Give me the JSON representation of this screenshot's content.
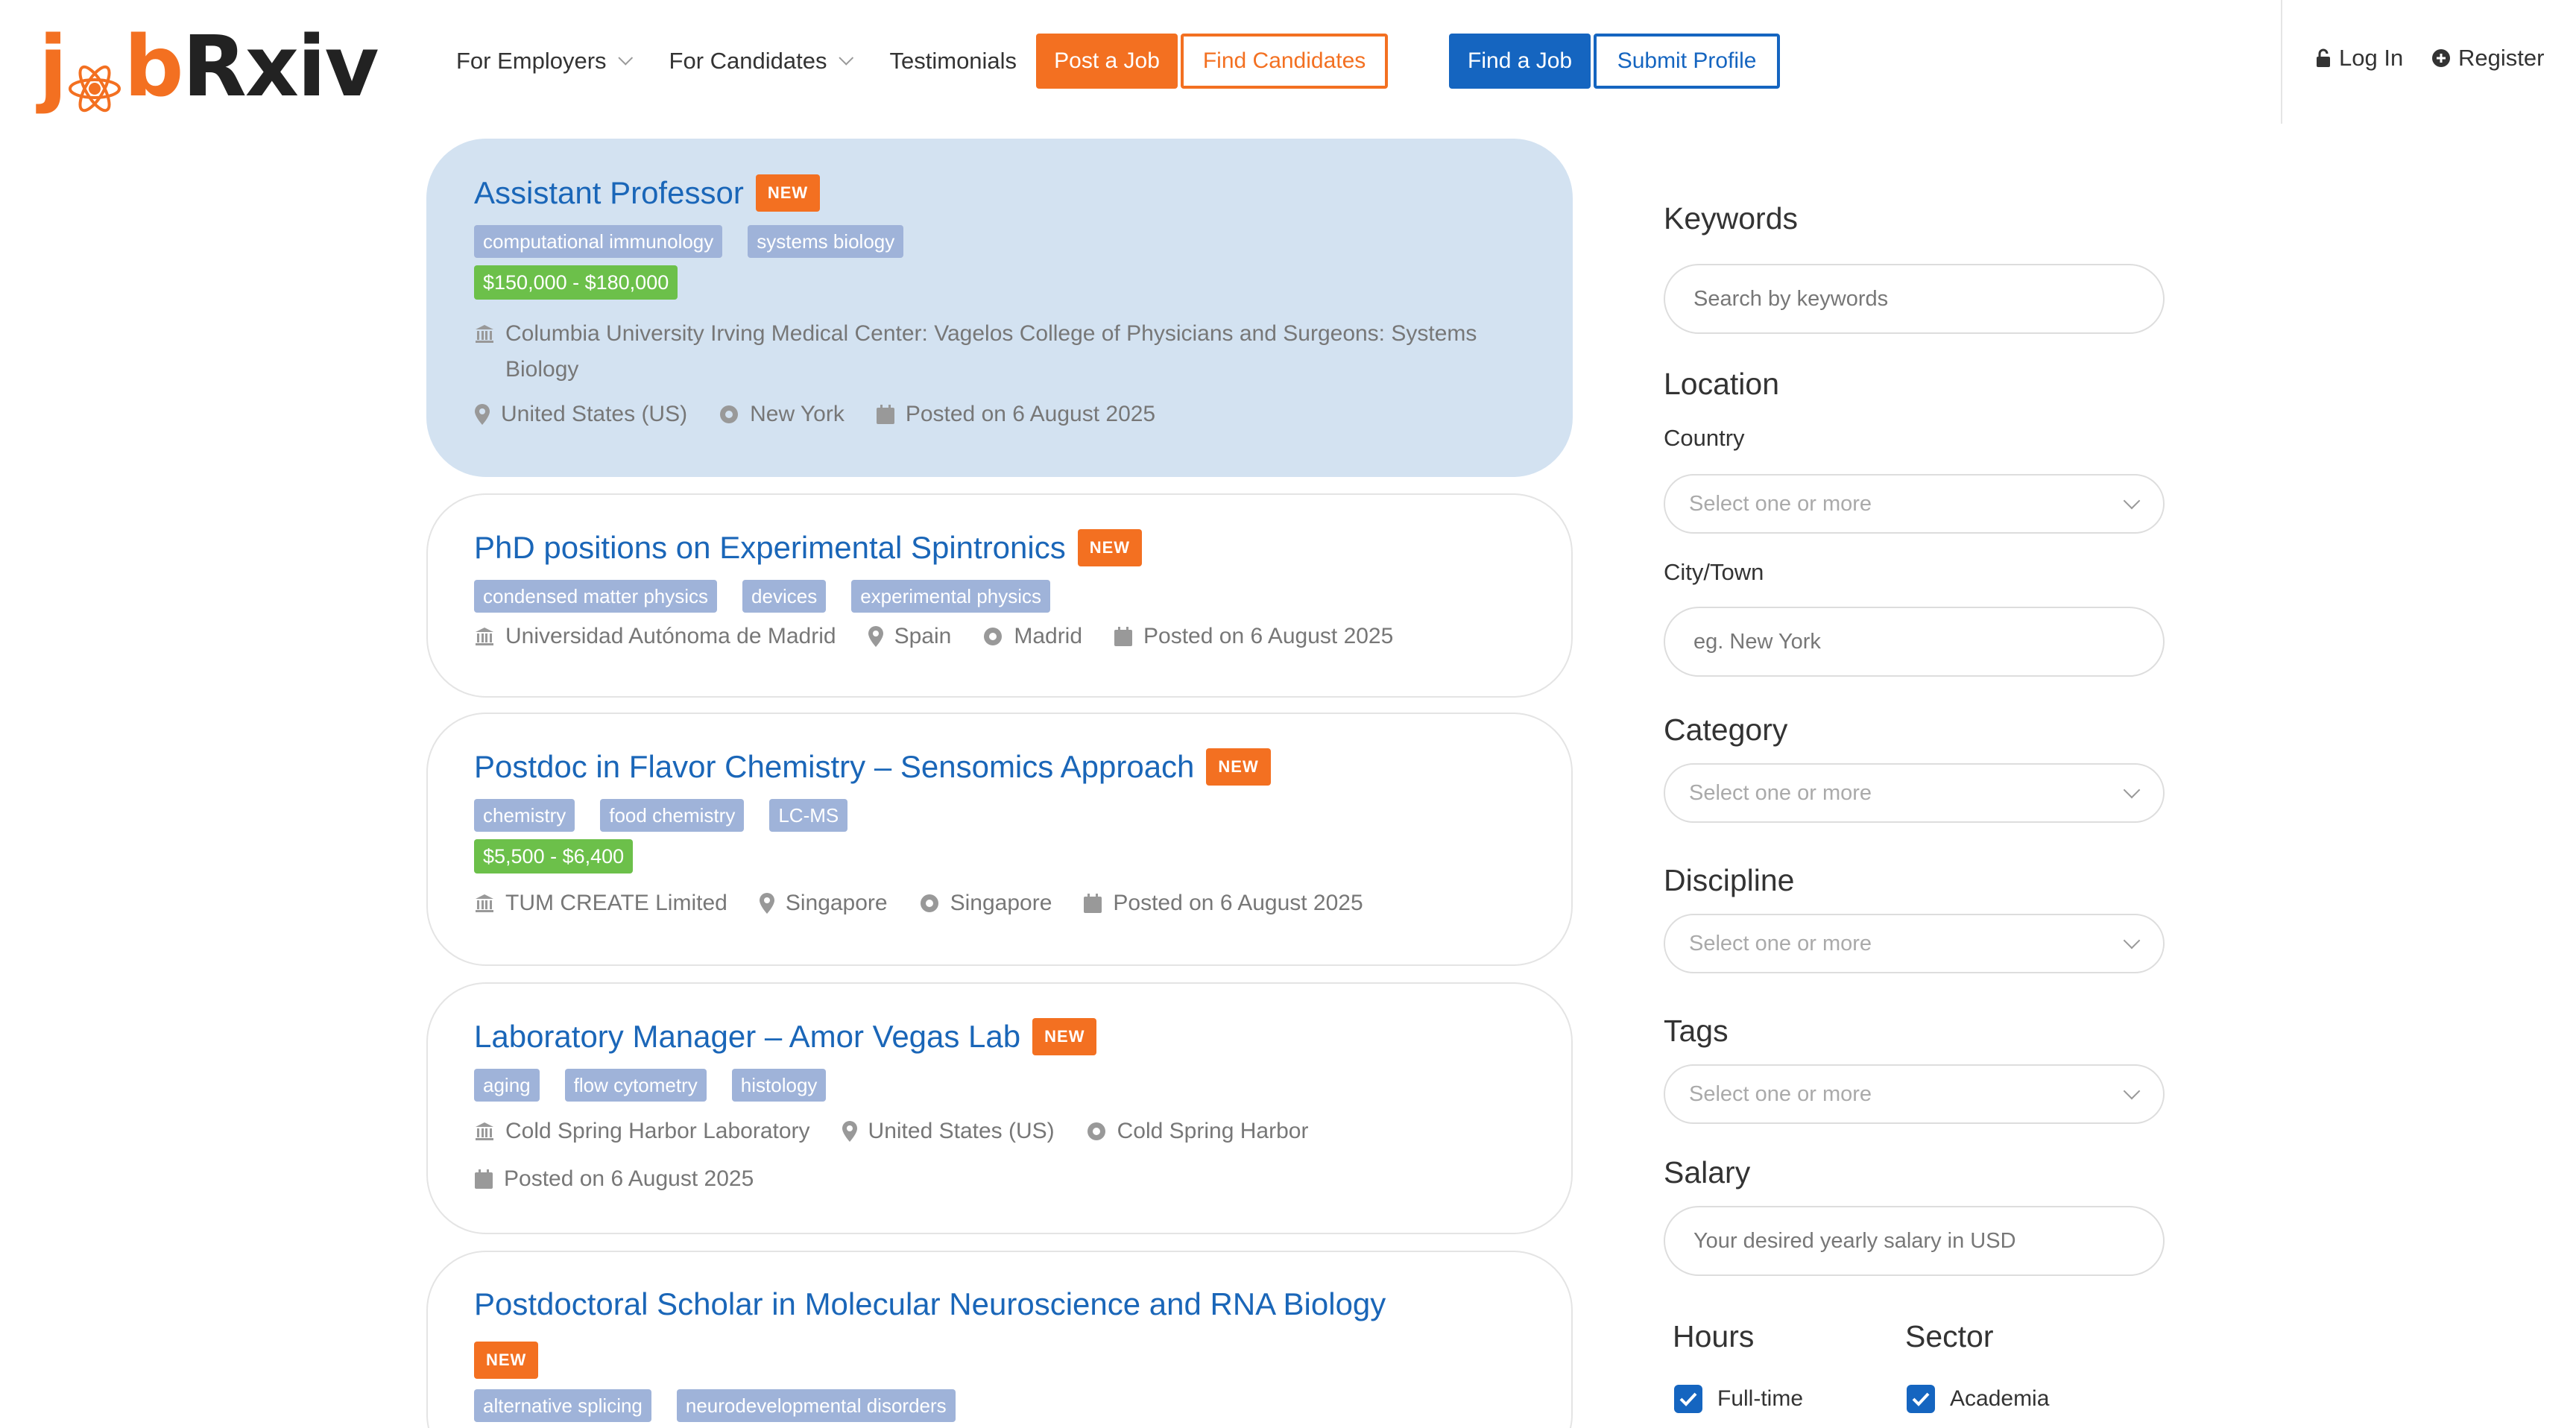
{
  "brand": {
    "logo_j": "j",
    "logo_b": "b",
    "logo_rest": "Rxiv",
    "orange": "#f37021",
    "blue": "#1565c0"
  },
  "nav": {
    "for_employers": "For Employers",
    "for_candidates": "For Candidates",
    "testimonials": "Testimonials",
    "post_job": "Post a Job",
    "find_candidates": "Find Candidates",
    "find_job": "Find a Job",
    "submit_profile": "Submit Profile",
    "login": "Log In",
    "register": "Register"
  },
  "jobs": [
    {
      "title": "Assistant Professor",
      "badge": "NEW",
      "tags": [
        "computational immunology",
        "systems biology"
      ],
      "salary": "$150,000 - $180,000",
      "institution": "Columbia University Irving Medical Center: Vagelos College of Physicians and Surgeons: Systems Biology",
      "country": "United States (US)",
      "city": "New York",
      "posted": "Posted on 6 August 2025"
    },
    {
      "title": "PhD positions on Experimental Spintronics",
      "badge": "NEW",
      "tags": [
        "condensed matter physics",
        "devices",
        "experimental physics"
      ],
      "institution": "Universidad Autónoma de Madrid",
      "country": "Spain",
      "city": "Madrid",
      "posted": "Posted on 6 August 2025"
    },
    {
      "title": "Postdoc in Flavor Chemistry – Sensomics Approach",
      "badge": "NEW",
      "tags": [
        "chemistry",
        "food chemistry",
        "LC-MS"
      ],
      "salary": "$5,500 - $6,400",
      "institution": "TUM CREATE Limited",
      "country": "Singapore",
      "city": "Singapore",
      "posted": "Posted on 6 August 2025"
    },
    {
      "title": "Laboratory Manager – Amor Vegas Lab",
      "badge": "NEW",
      "tags": [
        "aging",
        "flow cytometry",
        "histology"
      ],
      "institution": "Cold Spring Harbor Laboratory",
      "country": "United States (US)",
      "city": "Cold Spring Harbor",
      "posted": "Posted on 6 August 2025"
    },
    {
      "title": "Postdoctoral Scholar in Molecular Neuroscience and RNA Biology",
      "badge": "NEW",
      "tags": [
        "alternative splicing",
        "neurodevelopmental disorders"
      ]
    }
  ],
  "filters": {
    "keywords_heading": "Keywords",
    "keywords_placeholder": "Search by keywords",
    "location_heading": "Location",
    "country_label": "Country",
    "country_placeholder": "Select one or more",
    "city_label": "City/Town",
    "city_placeholder": "eg. New York",
    "category_heading": "Category",
    "category_placeholder": "Select one or more",
    "discipline_heading": "Discipline",
    "discipline_placeholder": "Select one or more",
    "tags_heading": "Tags",
    "tags_placeholder": "Select one or more",
    "salary_heading": "Salary",
    "salary_placeholder": "Your desired yearly salary in USD",
    "hours_heading": "Hours",
    "hours_option": "Full-time",
    "sector_heading": "Sector",
    "sector_option": "Academia"
  }
}
